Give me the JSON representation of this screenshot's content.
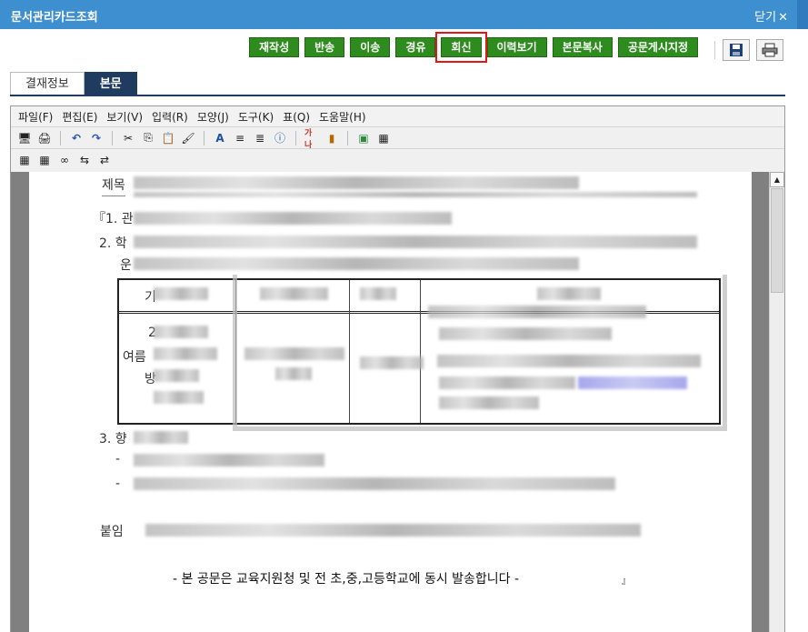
{
  "window": {
    "title": "문서관리카드조회",
    "close_label": "닫기"
  },
  "actions": [
    "재작성",
    "반송",
    "이송",
    "경유",
    "회신",
    "이력보기",
    "본문복사",
    "공문게시지정"
  ],
  "icons": {
    "save": "save-icon",
    "print": "print-icon"
  },
  "tabs": [
    "결재정보",
    "본문"
  ],
  "active_tab": "본문",
  "menu": [
    "파일(F)",
    "편집(E)",
    "보기(V)",
    "입력(R)",
    "모양(J)",
    "도구(K)",
    "표(Q)",
    "도움말(H)"
  ],
  "doc": {
    "title_label": "제목",
    "item1": "『1. 관",
    "item2": "2. 학",
    "item2_cont": "운",
    "cell_r1": "기",
    "cell_a": "2",
    "cell_b": "여름",
    "cell_c": "방",
    "item3": "3. 향",
    "dash1": "-",
    "dash2": "-",
    "attach_label": "붙임",
    "footer_note": "- 본 공문은 교육지원청 및 전 초,중,고등학교에 동시 발송합니다 -",
    "footer_mark": "』"
  },
  "colors": {
    "accent_green": "#2e8b1e",
    "titlebar": "#3e8fd0",
    "tab_active": "#1f3b5f",
    "highlight": "#e01818"
  }
}
